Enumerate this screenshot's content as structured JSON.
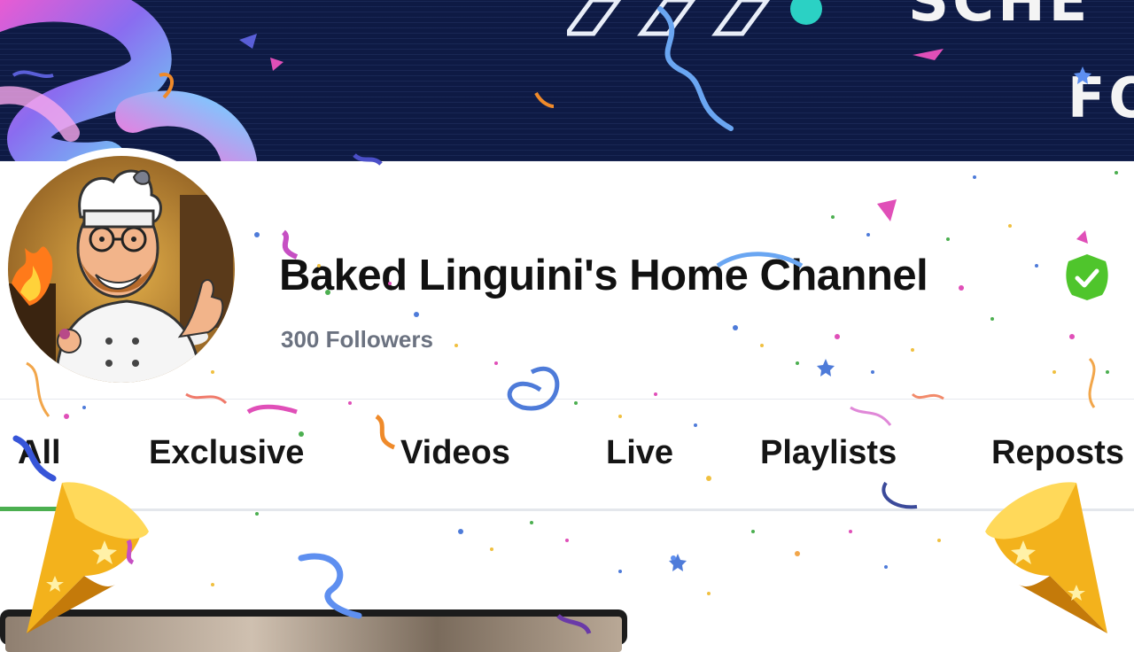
{
  "banner": {
    "text_line1": "SCHE",
    "text_line2": "FO"
  },
  "channel": {
    "name": "Baked Linguini's Home Channel",
    "followers": "300 Followers",
    "verified_color": "#4fc52c"
  },
  "tabs": [
    {
      "label": "All",
      "active": true
    },
    {
      "label": "Exclusive",
      "active": false
    },
    {
      "label": "Videos",
      "active": false
    },
    {
      "label": "Live",
      "active": false
    },
    {
      "label": "Playlists",
      "active": false
    },
    {
      "label": "Reposts",
      "active": false
    }
  ],
  "colors": {
    "accent": "#4caf50",
    "banner_bg": "#0e1a44"
  },
  "icons": {
    "verified": "check-badge-icon",
    "party_popper": "party-hat-icon"
  }
}
